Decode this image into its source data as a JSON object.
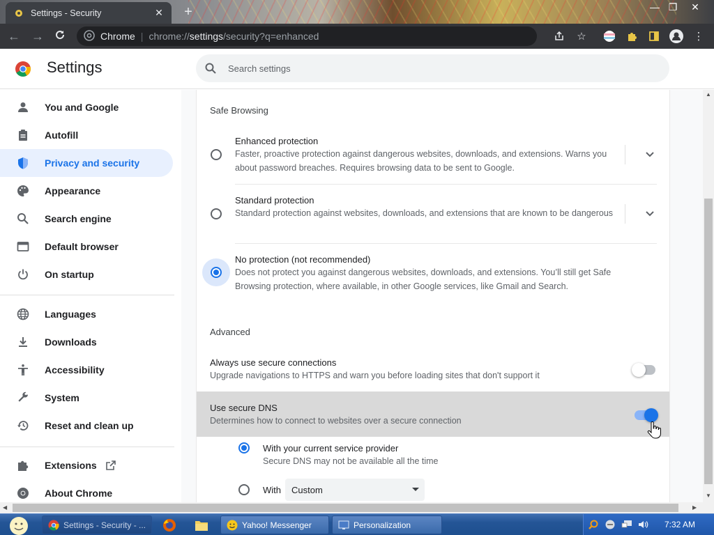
{
  "window": {
    "tab_title": "Settings - Security",
    "tab_close": "✕",
    "new_tab": "+",
    "controls": {
      "minimize": "—",
      "maximize": "❐",
      "close": "✕"
    }
  },
  "omnibox": {
    "site_label": "Chrome",
    "url_prefix": "chrome://",
    "url_host": "settings",
    "url_path": "/security?q=enhanced"
  },
  "header": {
    "title": "Settings",
    "search_placeholder": "Search settings"
  },
  "sidebar": {
    "items": [
      {
        "label": "You and Google",
        "icon": "person-icon"
      },
      {
        "label": "Autofill",
        "icon": "clipboard-icon"
      },
      {
        "label": "Privacy and security",
        "icon": "shield-icon",
        "active": true
      },
      {
        "label": "Appearance",
        "icon": "palette-icon"
      },
      {
        "label": "Search engine",
        "icon": "search-icon"
      },
      {
        "label": "Default browser",
        "icon": "browser-icon"
      },
      {
        "label": "On startup",
        "icon": "power-icon"
      },
      {
        "label": "Languages",
        "icon": "globe-icon"
      },
      {
        "label": "Downloads",
        "icon": "download-icon"
      },
      {
        "label": "Accessibility",
        "icon": "accessibility-icon"
      },
      {
        "label": "System",
        "icon": "wrench-icon"
      },
      {
        "label": "Reset and clean up",
        "icon": "history-icon"
      },
      {
        "label": "Extensions",
        "icon": "puzzle-icon"
      },
      {
        "label": "About Chrome",
        "icon": "chrome-icon"
      }
    ]
  },
  "safe_browsing": {
    "heading": "Safe Browsing",
    "options": [
      {
        "title": "Enhanced protection",
        "desc": "Faster, proactive protection against dangerous websites, downloads, and extensions. Warns you about password breaches. Requires browsing data to be sent to Google.",
        "selected": false
      },
      {
        "title": "Standard protection",
        "desc": "Standard protection against websites, downloads, and extensions that are known to be dangerous",
        "selected": false
      },
      {
        "title": "No protection (not recommended)",
        "desc": "Does not protect you against dangerous websites, downloads, and extensions. You’ll still get Safe Browsing protection, where available, in other Google services, like Gmail and Search.",
        "selected": true
      }
    ]
  },
  "advanced": {
    "heading": "Advanced",
    "https_title": "Always use secure connections",
    "https_desc": "Upgrade navigations to HTTPS and warn you before loading sites that don't support it",
    "https_enabled": false,
    "dns_title": "Use secure DNS",
    "dns_desc": "Determines how to connect to websites over a secure connection",
    "dns_enabled": true,
    "dns_opt1_title": "With your current service provider",
    "dns_opt1_desc": "Secure DNS may not be available all the time",
    "dns_opt2_label": "With",
    "dns_provider_value": "Custom"
  },
  "taskbar": {
    "buttons": [
      {
        "label": "Settings - Security - ...",
        "active": true
      },
      {
        "label": "Yahoo! Messenger"
      },
      {
        "label": "Personalization"
      }
    ],
    "clock": "7:32 AM"
  },
  "colors": {
    "accent": "#1a73e8",
    "active_bg": "#e8f0fe",
    "toolbar": "#35363a",
    "taskbar": "#245596"
  }
}
